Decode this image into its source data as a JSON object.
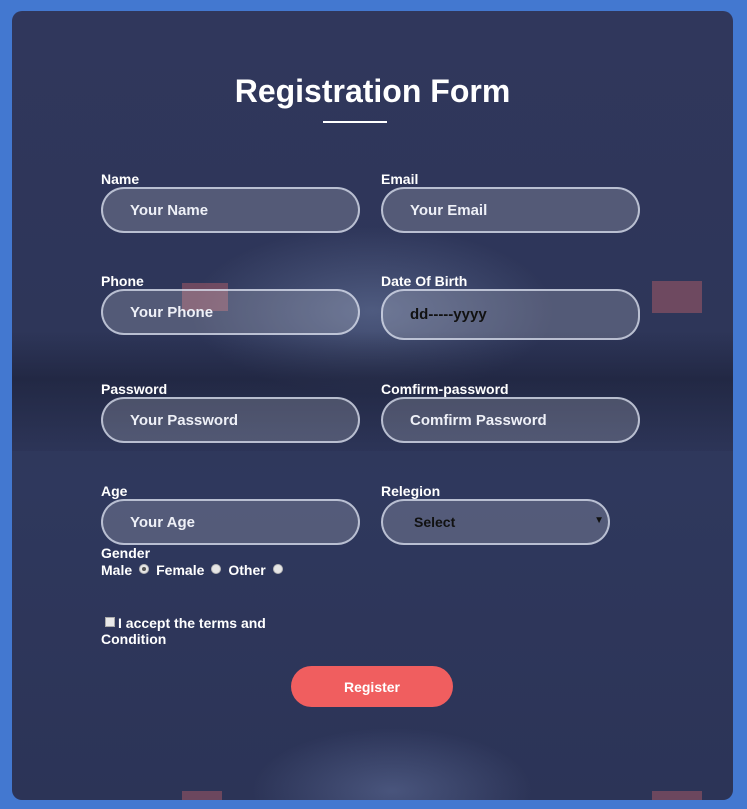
{
  "form": {
    "title": "Registration Form",
    "fields": {
      "name": {
        "label": "Name",
        "placeholder": "Your Name"
      },
      "email": {
        "label": "Email",
        "placeholder": "Your Email"
      },
      "phone": {
        "label": "Phone",
        "placeholder": "Your Phone"
      },
      "dob": {
        "label": "Date Of Birth",
        "placeholder": "dd-----yyyy"
      },
      "password": {
        "label": "Password",
        "placeholder": "Your Password"
      },
      "confirm_password": {
        "label": "Comfirm-password",
        "placeholder": "Comfirm Password"
      },
      "age": {
        "label": "Age",
        "placeholder": "Your Age"
      },
      "religion": {
        "label": "Relegion",
        "selected": "Select"
      }
    },
    "gender": {
      "label": "Gender",
      "options": [
        "Male",
        "Female",
        "Other"
      ],
      "checked_index": 0
    },
    "terms": {
      "label": "I accept the terms and Condition",
      "checked": false
    },
    "submit_label": "Register"
  },
  "colors": {
    "page_background": "#4378d0",
    "card_background": "#2f375c",
    "button": "#f05e5f"
  }
}
